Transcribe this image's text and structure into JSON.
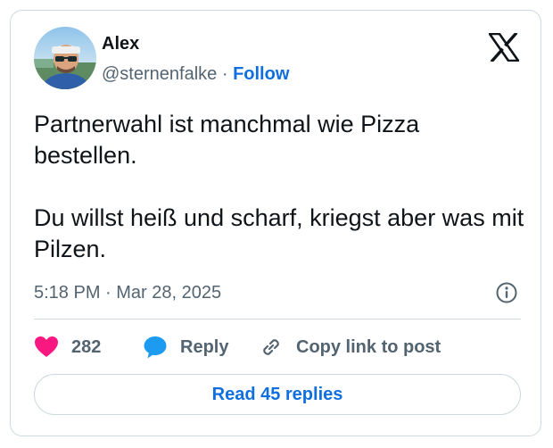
{
  "tweet": {
    "author_name": "Alex",
    "handle": "@sternenfalke",
    "separator": "·",
    "follow_label": "Follow",
    "text_paragraphs": [
      "Partnerwahl ist manchmal wie Pizza bestellen.",
      "Du willst heiß und scharf, kriegst aber was mit Pilzen."
    ],
    "timestamp": "5:18 PM · Mar 28, 2025"
  },
  "actions": {
    "like_count": "282",
    "reply_label": "Reply",
    "copy_link_label": "Copy link to post"
  },
  "footer": {
    "read_replies_label": "Read 45 replies"
  },
  "icons": {
    "logo": "x-logo-icon",
    "info": "info-icon",
    "like": "heart-icon",
    "reply": "speech-bubble-icon",
    "copy_link": "link-icon"
  },
  "colors": {
    "accent": "#0f6fde",
    "like": "#f91880",
    "reply_bubble": "#1d9bf0",
    "text_primary": "#0f1419",
    "text_secondary": "#536471",
    "border": "#cfd9de"
  }
}
